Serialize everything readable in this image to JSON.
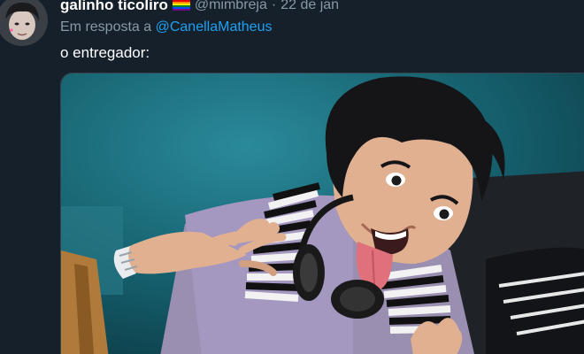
{
  "author": {
    "display_name": "galinho ticoliro",
    "name_emoji": "rainbow-flag-icon",
    "handle": "@mimbreja",
    "separator": "·",
    "date": "22 de jan"
  },
  "reply": {
    "prefix": "Em resposta a",
    "mention": "@CanellaMatheus"
  },
  "tweet": {
    "text": "o entregador:"
  },
  "media": {
    "type": "photo",
    "icon": "photo-icon"
  },
  "colors": {
    "background": "#15202b",
    "primary_text": "#ffffff",
    "secondary_text": "#8899a6",
    "link": "#1da1f2"
  }
}
